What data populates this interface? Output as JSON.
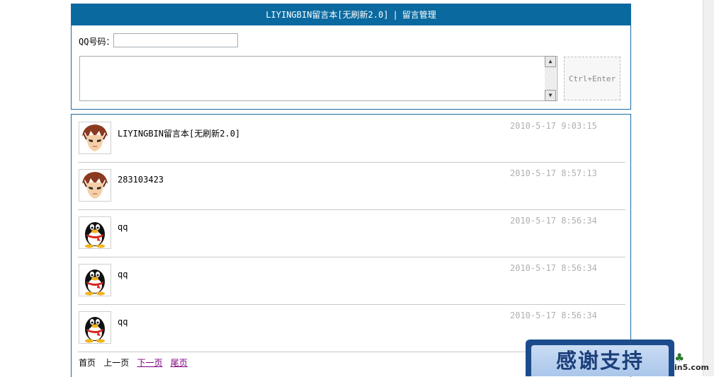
{
  "header": {
    "title": "LIYINGBIN留言本[无刷新2.0]",
    "separator": "|",
    "admin_link": "留言管理"
  },
  "form": {
    "qq_label": "QQ号码：",
    "qq_value": "",
    "message_value": "",
    "submit_label": "Ctrl+Enter"
  },
  "entries": [
    {
      "avatar": "anime-boy-avatar",
      "text": "LIYINGBIN留言本[无刷新2.0]",
      "time": "2010-5-17 9:03:15"
    },
    {
      "avatar": "anime-boy-avatar",
      "text": "283103423",
      "time": "2010-5-17 8:57:13"
    },
    {
      "avatar": "qq-penguin-avatar",
      "text": "qq",
      "time": "2010-5-17 8:56:34"
    },
    {
      "avatar": "qq-penguin-avatar",
      "text": "qq",
      "time": "2010-5-17 8:56:34"
    },
    {
      "avatar": "qq-penguin-avatar",
      "text": "qq",
      "time": "2010-5-17 8:56:34"
    }
  ],
  "pager": {
    "first": "首页",
    "prev": "上一页",
    "next": "下一页",
    "last": "尾页"
  },
  "badge": {
    "thanks": "感谢支持",
    "watermark": "in5.com"
  },
  "colors": {
    "header_bg": "#0a6aa0",
    "border": "#1f6aa0",
    "link_visited": "#800080",
    "timestamp": "#b0b0b0"
  }
}
